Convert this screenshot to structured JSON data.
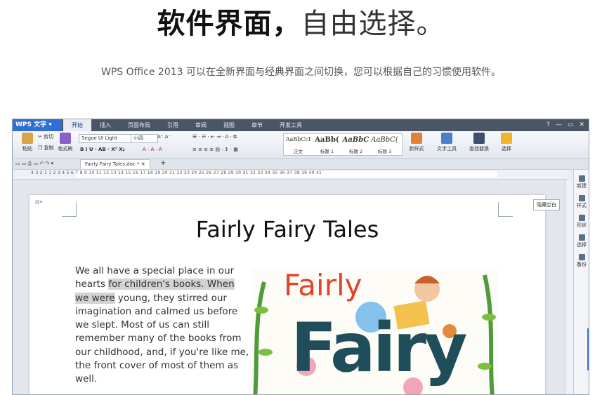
{
  "hero": {
    "title_bold": "软件界面",
    "title_comma": "，",
    "title_light": "自由选择。",
    "subtitle": "WPS Office 2013 可以在全新界面与经典界面之间切换，您可以根据自己的习惯使用软件。"
  },
  "app": {
    "brand": "WPS 文字",
    "menus": [
      "开始",
      "插入",
      "页面布局",
      "引用",
      "审阅",
      "视图",
      "章节",
      "开发工具"
    ],
    "win_controls": [
      "?",
      "—",
      "▭",
      "✕"
    ],
    "ribbon": {
      "paste": "粘贴",
      "cut": "剪切",
      "copy": "复制",
      "format_painter": "格式刷",
      "font_name": "Segoe UI Light",
      "font_size": "小四",
      "styles": [
        {
          "preview": "AaBbCcI",
          "name": "正文"
        },
        {
          "preview": "AaBb(",
          "name": "标题 1"
        },
        {
          "preview": "AaBbC",
          "name": "标题 2"
        },
        {
          "preview": "AaBbC(",
          "name": "标题 3"
        }
      ],
      "new_style": "新样式",
      "text_tools": "文字工具",
      "find_replace": "查找替换",
      "select": "选择"
    },
    "tab_filename": "Fairly Fairy Tales.doc *",
    "ruler_numbers": "4  3  2  1     1  2  3  4  5  6  7  8  9  10  11  12  13  14  15  16  17  18  19  20  21  22  23  24  25  26  27  28  29  30  31  32  33  34  35  36  37  38  39  40  41",
    "document": {
      "title": "Fairly Fairy Tales",
      "para_line1": "We all have a special place in our hearts",
      "para_highlight": "for children's books. When we were",
      "para_rest": "young, they stirred our imagination and calmed us before we slept. Most of us can still remember many of the books from our childhood, and, if you're like me, the front cover of most of them as well.",
      "cover_word1": "Fairly",
      "cover_word2": "Fairy"
    },
    "tooltip": "隐藏空白",
    "side_panel": [
      "新建",
      "样式",
      "形状",
      "选择",
      "备份"
    ],
    "colors": {
      "brand": "#2f6fd2",
      "menubar": "#4a5566",
      "accent": "#3a7be0"
    }
  }
}
